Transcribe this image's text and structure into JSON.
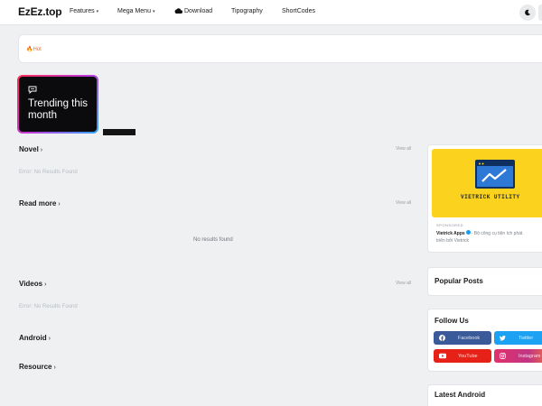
{
  "site": {
    "logo": "EzEz.top"
  },
  "nav": {
    "features": "Features",
    "mega_menu": "Mega Menu",
    "download": "Download",
    "typography": "Tipography",
    "shortcodes": "ShortCodes"
  },
  "hot": {
    "label": "Hot"
  },
  "trending": {
    "title": "Trending this month"
  },
  "sections": {
    "novel": {
      "title": "Novel",
      "view_all": "View all",
      "message": "Error: No Results Found"
    },
    "read_more": {
      "title": "Read more",
      "view_all": "View all",
      "message": "No results found"
    },
    "videos": {
      "title": "Videos",
      "view_all": "View all",
      "message": "Error: No Results Found"
    },
    "android": {
      "title": "Android"
    },
    "resource": {
      "title": "Resource"
    }
  },
  "sidebar": {
    "ad": {
      "brand": "VIETRICK UTILITY",
      "sponsored": "SPONSORED",
      "advertiser": "Vietrick Apps",
      "description": "- Bộ công cụ tiện ích phát",
      "description_2": "triển bởi Vietrick"
    },
    "popular_posts": "Popular Posts",
    "follow_us": "Follow Us",
    "social": {
      "facebook": "Facebook",
      "twitter": "Twitter",
      "youtube": "YouTube",
      "instagram": "Instagram"
    },
    "latest_android": "Latest Android"
  },
  "colors": {
    "facebook": "#3a5a99",
    "twitter": "#1da1f2",
    "youtube": "#e62117",
    "instagram": "#d4378b",
    "ad_yellow": "#fbd31e",
    "hot": "#e8712c"
  },
  "icons": {
    "download": "cloud-download-icon",
    "theme": "moon-icon",
    "hot": "fire-icon",
    "trending": "chat-bubble-icon"
  }
}
